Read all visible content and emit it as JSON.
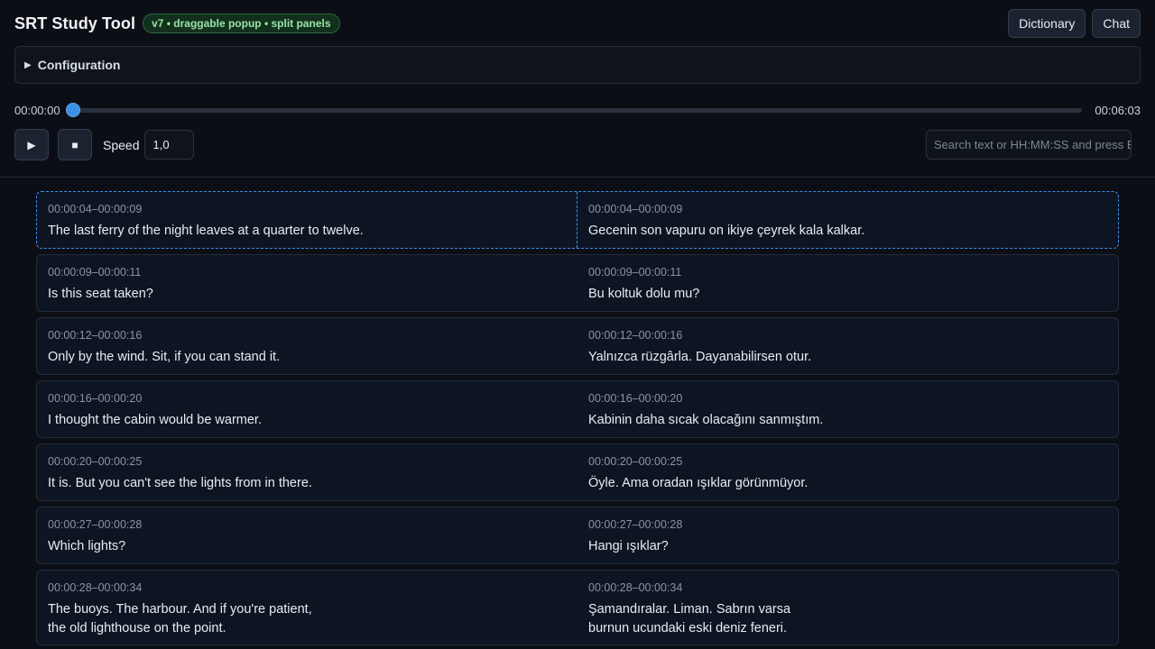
{
  "header": {
    "title": "SRT Study Tool",
    "version_badge": "v7 • draggable popup • split panels",
    "dictionary_label": "Dictionary",
    "chat_label": "Chat"
  },
  "config": {
    "label": "Configuration",
    "expanded": false
  },
  "player": {
    "current_time": "00:00:00",
    "total_time": "00:06:03",
    "progress": 0,
    "play_icon": "▶",
    "stop_icon": "■",
    "speed_label": "Speed",
    "speed_value": "1,0",
    "search_placeholder": "Search text or HH:MM:SS and press Enter"
  },
  "colors": {
    "accent": "#3b8fe6",
    "badge_bg": "#12301d",
    "badge_text": "#9be3a5"
  },
  "cues": [
    {
      "time_left": "00:00:04–00:00:09",
      "text_left": "The last ferry of the night leaves at a quarter to twelve.",
      "time_right": "00:00:04–00:00:09",
      "text_right": "Gecenin son vapuru on ikiye çeyrek kala kalkar.",
      "active": true
    },
    {
      "time_left": "00:00:09–00:00:11",
      "text_left": "Is this seat taken?",
      "time_right": "00:00:09–00:00:11",
      "text_right": "Bu koltuk dolu mu?"
    },
    {
      "time_left": "00:00:12–00:00:16",
      "text_left": "Only by the wind. Sit, if you can stand it.",
      "time_right": "00:00:12–00:00:16",
      "text_right": "Yalnızca rüzgârla. Dayanabilirsen otur."
    },
    {
      "time_left": "00:00:16–00:00:20",
      "text_left": "I thought the cabin would be warmer.",
      "time_right": "00:00:16–00:00:20",
      "text_right": "Kabinin daha sıcak olacağını sanmıştım."
    },
    {
      "time_left": "00:00:20–00:00:25",
      "text_left": "It is. But you can't see the lights from in there.",
      "time_right": "00:00:20–00:00:25",
      "text_right": "Öyle. Ama oradan ışıklar görünmüyor."
    },
    {
      "time_left": "00:00:27–00:00:28",
      "text_left": "Which lights?",
      "time_right": "00:00:27–00:00:28",
      "text_right": "Hangi ışıklar?"
    },
    {
      "time_left": "00:00:28–00:00:34",
      "text_left": "The buoys. The harbour. And if you're patient,\nthe old lighthouse on the point.",
      "time_right": "00:00:28–00:00:34",
      "text_right": "Şamandıralar. Liman. Sabrın varsa\nburnun ucundaki eski deniz feneri.",
      "multiline": true
    }
  ]
}
